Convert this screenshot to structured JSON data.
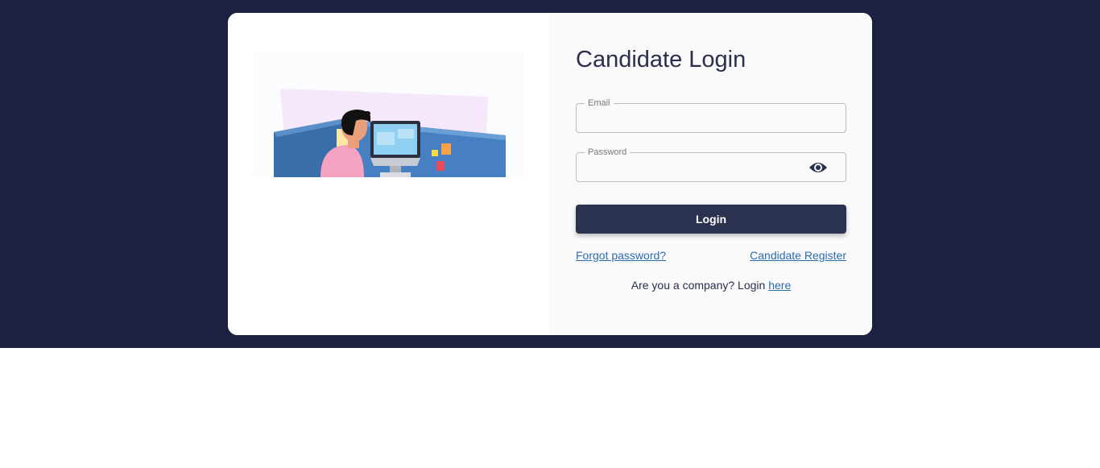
{
  "login": {
    "title": "Candidate Login",
    "email": {
      "label": "Email",
      "value": ""
    },
    "password": {
      "label": "Password",
      "value": "",
      "toggle_icon": "eye-icon"
    },
    "submit_label": "Login",
    "forgot_password_label": "Forgot password?",
    "register_label": "Candidate Register",
    "company_prompt": "Are you a company? Login ",
    "company_link_label": "here"
  },
  "illustration": {
    "icon": "person-at-desk-illustration"
  },
  "colors": {
    "page_background": "#1d2140",
    "card_left": "#ffffff",
    "card_right": "#fafafa",
    "button": "#2b3250",
    "link": "#2b6cb0",
    "title": "#2a2f4f"
  }
}
